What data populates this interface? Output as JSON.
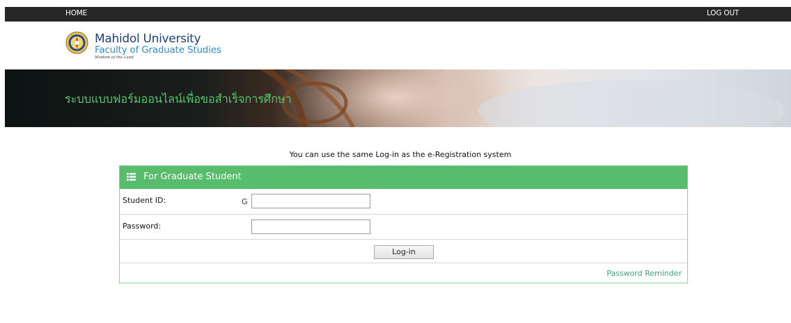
{
  "nav": {
    "home": "HOME",
    "logout": "LOG OUT"
  },
  "logo": {
    "title": "Mahidol University",
    "subtitle": "Faculty of Graduate Studies",
    "motto": "Wisdom of the Land",
    "icon": "mahidol-seal"
  },
  "banner": {
    "title": "ระบบแบบฟอร์มออนไลน์เพื่อขอสำเร็จการศึกษา"
  },
  "login": {
    "notice": "You can use the same Log-in as the e-Registration system",
    "header": "For Graduate Student",
    "header_icon": "list-icon",
    "student_id_label": "Student ID:",
    "student_id_prefix": "G",
    "student_id_value": "",
    "password_label": "Password:",
    "password_value": "",
    "button": "Log-in",
    "reminder": "Password Reminder"
  },
  "colors": {
    "topbar": "#262626",
    "accent_green": "#57bd6c",
    "banner_title": "#55c46f",
    "link": "#3aa57a"
  }
}
